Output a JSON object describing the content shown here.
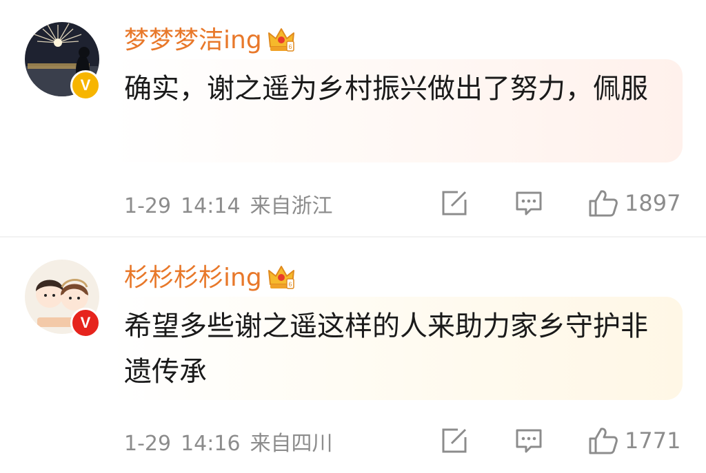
{
  "comments": [
    {
      "username": "梦梦梦洁ing",
      "verified_badge": "V",
      "badge_color": "#f7b500",
      "text": "确实，谢之遥为乡村振兴做出了努力，佩服",
      "date": "1-29",
      "time": "14:14",
      "location": "来自浙江",
      "likes": "1897"
    },
    {
      "username": "杉杉杉杉ing",
      "verified_badge": "V",
      "badge_color": "#e6241d",
      "text": "希望多些谢之遥这样的人来助力家乡守护非遗传承",
      "date": "1-29",
      "time": "14:16",
      "location": "来自四川",
      "likes": "1771"
    }
  ],
  "colors": {
    "username": "#e8782a",
    "meta": "#8c8c8c",
    "text": "#1a1a1a"
  },
  "icons": {
    "share": "share-icon",
    "comment": "comment-icon",
    "like": "thumbs-up-icon",
    "crown": "crown-icon"
  }
}
